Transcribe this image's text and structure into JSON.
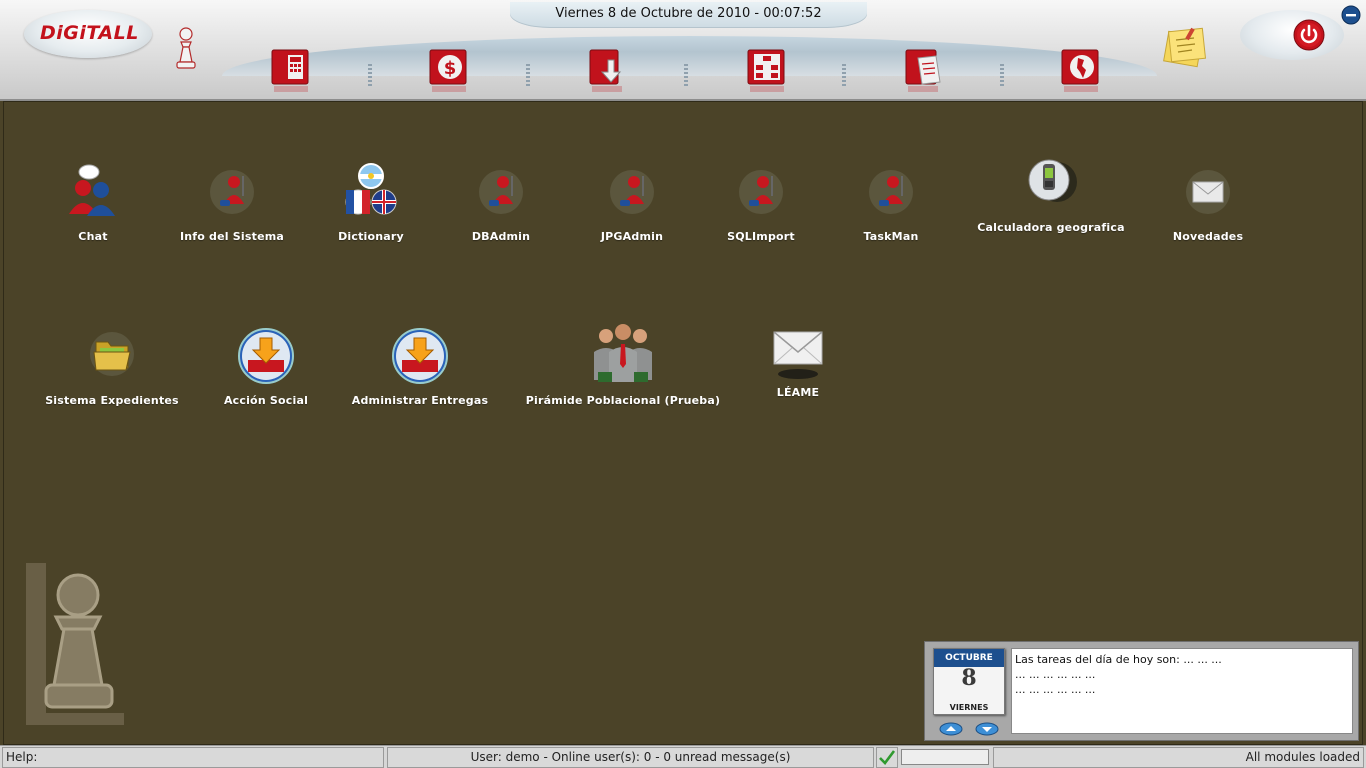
{
  "header": {
    "logo_text": "DiGiTALL",
    "datetime": "Viernes 8 de Octubre de 2010 - 00:07:52",
    "toolbar": [
      {
        "icon": "calculator-book-icon"
      },
      {
        "icon": "dollar-book-icon"
      },
      {
        "icon": "download-book-icon"
      },
      {
        "icon": "org-chart-book-icon"
      },
      {
        "icon": "documents-book-icon"
      },
      {
        "icon": "map-book-icon"
      }
    ],
    "colors": {
      "brand_red": "#c3121c",
      "desktop_bg": "#4b4328",
      "calendar_blue": "#1d4f8e"
    }
  },
  "desktop": {
    "icons": [
      {
        "label": "Chat",
        "icon": "chat-users-icon"
      },
      {
        "label": "Info del Sistema",
        "icon": "user-tool-icon"
      },
      {
        "label": "Dictionary",
        "icon": "flags-icon"
      },
      {
        "label": "DBAdmin",
        "icon": "user-tool-icon"
      },
      {
        "label": "JPGAdmin",
        "icon": "user-tool-icon"
      },
      {
        "label": "SQLImport",
        "icon": "user-tool-icon"
      },
      {
        "label": "TaskMan",
        "icon": "user-tool-icon"
      },
      {
        "label": "Calculadora geografica",
        "icon": "gps-device-icon"
      },
      {
        "label": "Novedades",
        "icon": "envelope-icon"
      },
      {
        "label": "Sistema Expedientes",
        "icon": "folder-icon"
      },
      {
        "label": "Acción Social",
        "icon": "inbox-download-icon"
      },
      {
        "label": "Administrar Entregas",
        "icon": "inbox-download-icon"
      },
      {
        "label": "Pirámide Poblacional (Prueba)",
        "icon": "business-people-icon"
      },
      {
        "label": "LÉAME",
        "icon": "envelope-icon"
      }
    ]
  },
  "tasks_widget": {
    "calendar": {
      "month": "OCTUBRE",
      "day": "8",
      "weekday": "VIERNES"
    },
    "lines": [
      "Las tareas del día de hoy son: ... ... ...",
      "... ... ... ... ... ...",
      "... ... ... ... ... ..."
    ]
  },
  "statusbar": {
    "help": "Help:",
    "user": "User: demo - Online user(s): 0 - 0 unread message(s)",
    "modules": "All modules loaded"
  }
}
